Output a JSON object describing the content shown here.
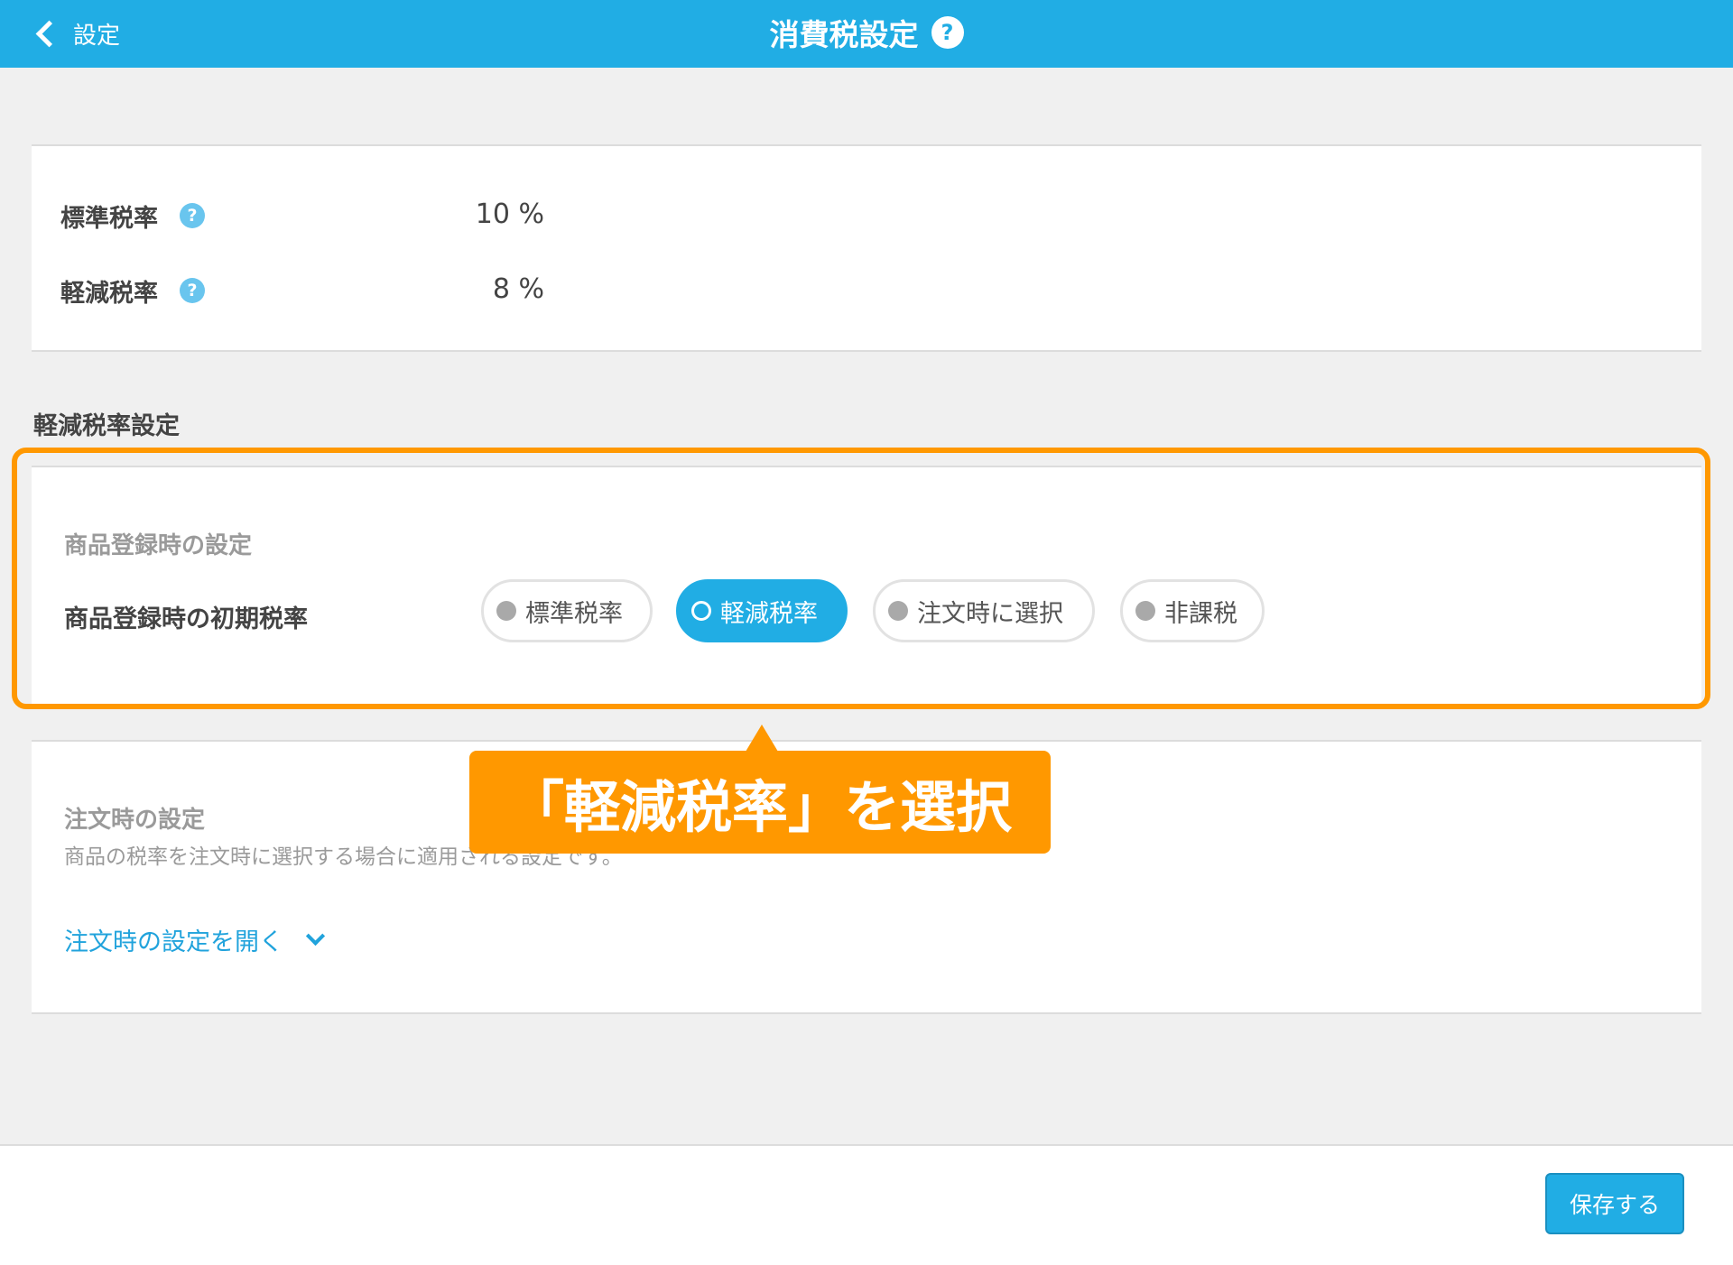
{
  "header": {
    "back_label": "設定",
    "title": "消費税設定",
    "help_symbol": "?"
  },
  "tax_rates": [
    {
      "label": "標準税率",
      "help_symbol": "?",
      "value": "10 %"
    },
    {
      "label": "軽減税率",
      "help_symbol": "?",
      "value": "8 %"
    }
  ],
  "reduced_settings": {
    "heading": "軽減税率設定",
    "product_section": {
      "sub_heading": "商品登録時の設定",
      "row_label": "商品登録時の初期税率",
      "options": [
        {
          "label": "標準税率",
          "selected": false
        },
        {
          "label": "軽減税率",
          "selected": true
        },
        {
          "label": "注文時に選択",
          "selected": false
        },
        {
          "label": "非課税",
          "selected": false
        }
      ]
    }
  },
  "callout": {
    "text": "「軽減税率」を選択"
  },
  "order_section": {
    "sub_heading": "注文時の設定",
    "description": "商品の税率を注文時に選択する場合に適用される設定です。",
    "open_link": "注文時の設定を開く"
  },
  "footer": {
    "save_label": "保存する"
  },
  "colors": {
    "accent": "#21ade4",
    "highlight": "#ff9800",
    "link": "#21a3dc"
  }
}
